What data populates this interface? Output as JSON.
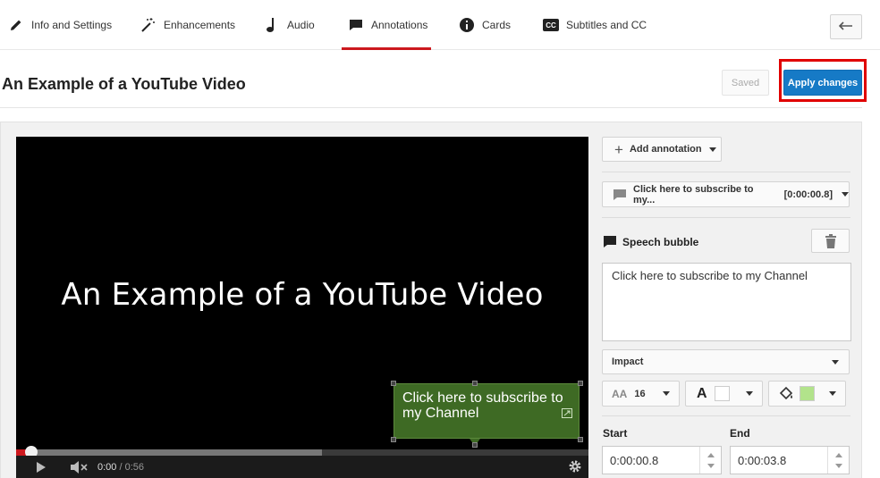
{
  "nav": {
    "tabs": [
      {
        "label": "Info and Settings",
        "icon": "pencil-icon"
      },
      {
        "label": "Enhancements",
        "icon": "magic-wand-icon"
      },
      {
        "label": "Audio",
        "icon": "music-note-icon"
      },
      {
        "label": "Annotations",
        "icon": "speech-bubble-icon",
        "active": true
      },
      {
        "label": "Cards",
        "icon": "info-icon"
      },
      {
        "label": "Subtitles and CC",
        "icon": "cc-icon"
      }
    ],
    "back_icon": "back-arrow-icon",
    "active_color": "#cc181e"
  },
  "header": {
    "title": "An Example of a YouTube Video",
    "saved_label": "Saved",
    "apply_label": "Apply changes",
    "apply_color": "#167ac6",
    "highlight_color": "#e00000"
  },
  "video": {
    "title_text": "An Example of a YouTube Video",
    "annotation_text": "Click here to subscribe to my Channel",
    "bubble_color": "#3e6a24",
    "current_time": "0:00",
    "duration": "0:56",
    "time_separator": " / ",
    "progress_played_fraction": 0.027,
    "progress_loaded_fraction": 0.534
  },
  "editor": {
    "add_annotation_label": "Add annotation",
    "selected_annotation": {
      "label": "Click here to subscribe to my...",
      "timestamp": "[0:00:00.8]"
    },
    "type_label": "Speech bubble",
    "text_value": "Click here to subscribe to my Channel",
    "font_value": "Impact",
    "font_size_value": "16",
    "text_color": "#ffffff",
    "background_color": "#b2e38b",
    "start_label": "Start",
    "start_value": "0:00:00.8",
    "end_label": "End",
    "end_value": "0:00:03.8"
  }
}
